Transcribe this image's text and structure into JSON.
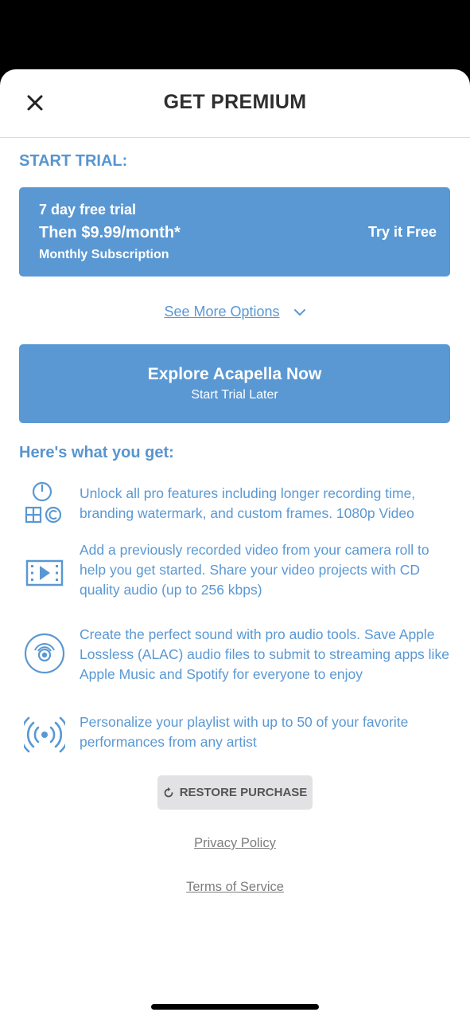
{
  "header": {
    "title": "GET PREMIUM"
  },
  "trial": {
    "section_label": "START TRIAL:",
    "line1": "7 day free trial",
    "line2": "Then $9.99/month*",
    "line3": "Monthly Subscription",
    "cta": "Try it Free"
  },
  "see_more": "See More Options",
  "explore": {
    "main": "Explore Acapella Now",
    "sub": "Start Trial Later"
  },
  "features_label": "Here's what you get:",
  "features": [
    {
      "icon": "pro-features-icon",
      "text": "Unlock all pro features including longer recording time, branding watermark, and custom frames. 1080p Video"
    },
    {
      "icon": "video-film-icon",
      "text": "Add a previously recorded video from your camera roll to help you get started. Share your video projects with CD quality audio (up to 256 kbps)"
    },
    {
      "icon": "speaker-disc-icon",
      "text": "Create the perfect sound with pro audio tools. Save Apple Lossless (ALAC) audio files to submit to streaming apps like Apple Music and Spotify for everyone to enjoy"
    },
    {
      "icon": "broadcast-icon",
      "text": "Personalize your playlist with up to 50 of your favorite performances from any artist"
    }
  ],
  "restore": "RESTORE PURCHASE",
  "privacy": "Privacy Policy",
  "terms": "Terms of Service",
  "colors": {
    "accent": "#5a98d3",
    "title": "#2f2f2f",
    "restore_bg": "#e2e2e4"
  }
}
